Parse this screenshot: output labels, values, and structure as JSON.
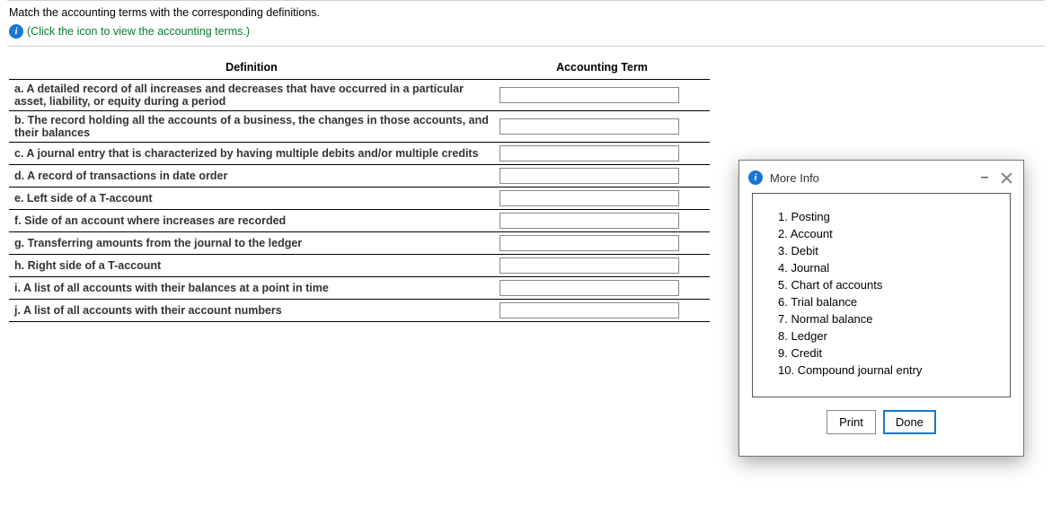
{
  "header": {
    "instruction": "Match the accounting terms with the corresponding definitions.",
    "hint": "(Click the icon to view the accounting terms.)"
  },
  "table": {
    "col_definition": "Definition",
    "col_term": "Accounting Term",
    "rows": [
      {
        "def": "a. A detailed record of all increases and decreases that have occurred in a particular asset, liability, or equity during a period",
        "val": ""
      },
      {
        "def": "b. The record holding all the accounts of a business, the changes in those accounts, and their balances",
        "val": ""
      },
      {
        "def": "c. A journal entry that is characterized by having multiple debits and/or multiple credits",
        "val": ""
      },
      {
        "def": "d. A record of transactions in date order",
        "val": ""
      },
      {
        "def": "e. Left side of a T-account",
        "val": ""
      },
      {
        "def": "f. Side of an account where increases are recorded",
        "val": ""
      },
      {
        "def": "g. Transferring amounts from the journal to the ledger",
        "val": ""
      },
      {
        "def": "h. Right side of a T-account",
        "val": ""
      },
      {
        "def": "i. A list of all accounts with their balances at a point in time",
        "val": ""
      },
      {
        "def": "j. A list of all accounts with their account numbers",
        "val": ""
      }
    ]
  },
  "modal": {
    "title": "More Info",
    "terms": [
      "Posting",
      "Account",
      "Debit",
      "Journal",
      "Chart of accounts",
      "Trial balance",
      "Normal balance",
      "Ledger",
      "Credit",
      "Compound journal entry"
    ],
    "print": "Print",
    "done": "Done"
  }
}
